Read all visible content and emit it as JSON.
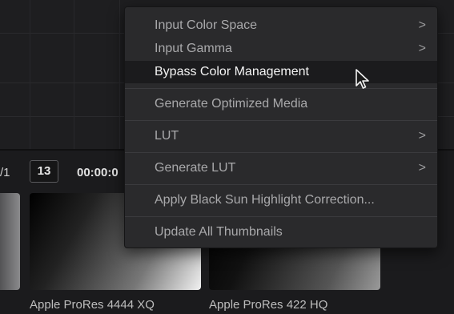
{
  "media_pool": {
    "page_counter": "/1",
    "page_number": "13",
    "timecode": "00:00:0",
    "clips": [
      {
        "label": "Apple ProRes 4444 XQ"
      },
      {
        "label": "Apple ProRes 422 HQ"
      }
    ]
  },
  "context_menu": {
    "items": [
      {
        "label": "Input Color Space",
        "submenu_icon": "chevron-right-icon"
      },
      {
        "label": "Input Gamma",
        "submenu_icon": "chevron-right-icon"
      },
      {
        "label": "Bypass Color Management",
        "hovered": true
      },
      {
        "label": "Generate Optimized Media"
      },
      {
        "label": "LUT",
        "submenu_icon": "chevron-right-icon"
      },
      {
        "label": "Generate LUT",
        "submenu_icon": "chevron-right-icon"
      },
      {
        "label": "Apply Black Sun Highlight Correction..."
      },
      {
        "label": "Update All Thumbnails"
      }
    ],
    "arrow_glyph": ">"
  },
  "colors": {
    "menu_background": "#2a2a2c",
    "menu_hover": "#1b1b1d",
    "menu_text": "#a9a9ab",
    "menu_text_hover": "#f4f4f4"
  }
}
